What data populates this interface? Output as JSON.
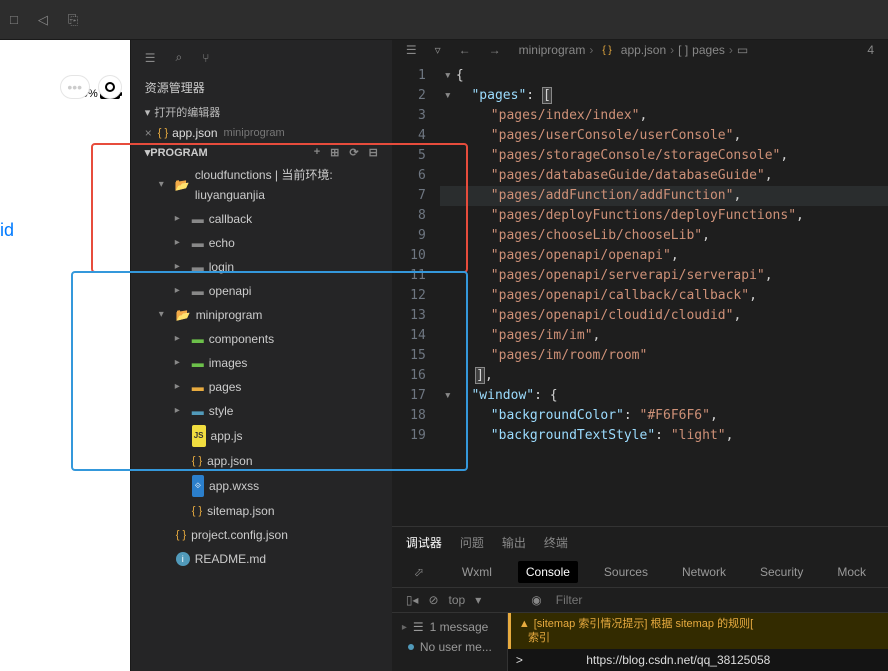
{
  "top_icons": [
    "□",
    "◁",
    "⎘"
  ],
  "phone": {
    "battery": "99%",
    "text": "id"
  },
  "explorer": {
    "title": "资源管理器",
    "editors_label": "打开的编辑器",
    "open_file": {
      "name": "app.json",
      "path": "miniprogram"
    },
    "program_label": "PROGRAM",
    "tree": {
      "cloudfunctions": {
        "label": "cloudfunctions | 当前环境: liuyanguanjia",
        "children": [
          "callback",
          "echo",
          "login",
          "openapi"
        ]
      },
      "miniprogram": {
        "label": "miniprogram",
        "children": [
          "components",
          "images",
          "pages",
          "style"
        ],
        "files": [
          "app.js",
          "app.json",
          "app.wxss",
          "sitemap.json"
        ]
      },
      "root_files": [
        "project.config.json",
        "README.md"
      ]
    }
  },
  "editor": {
    "tab": "app.json",
    "breadcrumb": {
      "root": "miniprogram",
      "file": "app.json",
      "key": "pages",
      "count": "4"
    },
    "lines": [
      {
        "n": 1,
        "type": "brace",
        "text": "{"
      },
      {
        "n": 2,
        "type": "key-arr",
        "key": "pages"
      },
      {
        "n": 3,
        "type": "str",
        "val": "pages/index/index"
      },
      {
        "n": 4,
        "type": "str",
        "val": "pages/userConsole/userConsole"
      },
      {
        "n": 5,
        "type": "str",
        "val": "pages/storageConsole/storageConsole"
      },
      {
        "n": 6,
        "type": "str",
        "val": "pages/databaseGuide/databaseGuide"
      },
      {
        "n": 7,
        "type": "str-hl",
        "val": "pages/addFunction/addFunction"
      },
      {
        "n": 8,
        "type": "str",
        "val": "pages/deployFunctions/deployFunctions"
      },
      {
        "n": 9,
        "type": "str",
        "val": "pages/chooseLib/chooseLib"
      },
      {
        "n": 10,
        "type": "str",
        "val": "pages/openapi/openapi"
      },
      {
        "n": 11,
        "type": "str",
        "val": "pages/openapi/serverapi/serverapi"
      },
      {
        "n": 12,
        "type": "str",
        "val": "pages/openapi/callback/callback"
      },
      {
        "n": 13,
        "type": "str",
        "val": "pages/openapi/cloudid/cloudid"
      },
      {
        "n": 14,
        "type": "str",
        "val": "pages/im/im"
      },
      {
        "n": 15,
        "type": "str-last",
        "val": "pages/im/room/room"
      },
      {
        "n": 16,
        "type": "close-arr"
      },
      {
        "n": 17,
        "type": "key-obj",
        "key": "window"
      },
      {
        "n": 18,
        "type": "kv",
        "key": "backgroundColor",
        "val": "#F6F6F6"
      },
      {
        "n": 19,
        "type": "kv",
        "key": "backgroundTextStyle",
        "val": "light"
      }
    ]
  },
  "bottom": {
    "tabs": [
      "调试器",
      "问题",
      "输出",
      "终端"
    ],
    "devtabs": [
      "Wxml",
      "Console",
      "Sources",
      "Network",
      "Security",
      "Mock"
    ],
    "console": {
      "context": "top",
      "filter_placeholder": "Filter"
    },
    "messages": {
      "count": "1 message",
      "nouser": "No user me...",
      "warning": "[sitemap 索引情况提示] 根据 sitemap 的规则[",
      "warning2": "索引"
    },
    "url": "https://blog.csdn.net/qq_38125058"
  }
}
